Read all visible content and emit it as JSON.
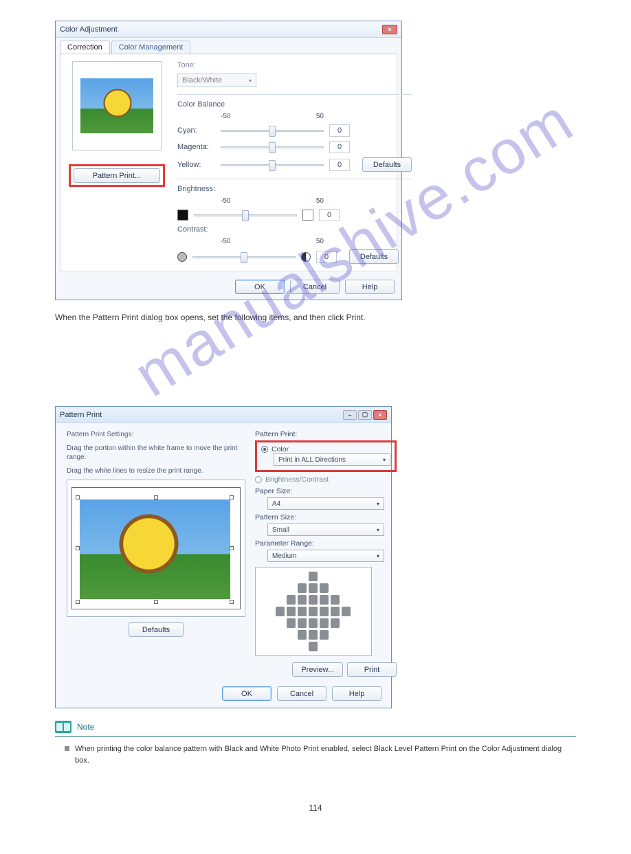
{
  "watermark": "manualshive.com",
  "intro_text": "When the Pattern Print dialog box opens, set the following items, and then click Print.",
  "dialog1": {
    "title": "Color Adjustment",
    "tabs": {
      "correction": "Correction",
      "management": "Color Management"
    },
    "tone_label": "Tone:",
    "tone_value": "Black/White",
    "color_balance_label": "Color Balance",
    "scale_min": "-50",
    "scale_max": "50",
    "cyan_label": "Cyan:",
    "magenta_label": "Magenta:",
    "yellow_label": "Yellow:",
    "zero": "0",
    "defaults_btn": "Defaults",
    "brightness_label": "Brightness:",
    "contrast_label": "Contrast:",
    "pattern_print_btn": "Pattern Print...",
    "ok": "OK",
    "cancel": "Cancel",
    "help": "Help"
  },
  "dialog2": {
    "title": "Pattern Print",
    "settings_heading": "Pattern Print Settings:",
    "hint1": "Drag the portion within the white frame to move the print range.",
    "hint2": "Drag the white lines to resize the print range.",
    "defaults_btn": "Defaults",
    "pattern_print_label": "Pattern Print:",
    "color_radio": "Color",
    "color_dd": "Print in ALL Directions",
    "bc_radio": "Brightness/Contrast",
    "paper_size_label": "Paper Size:",
    "paper_size_value": "A4",
    "pattern_size_label": "Pattern Size:",
    "pattern_size_value": "Small",
    "param_range_label": "Parameter Range:",
    "param_range_value": "Medium",
    "preview_btn": "Preview...",
    "print_btn": "Print",
    "ok": "OK",
    "cancel": "Cancel",
    "help": "Help"
  },
  "note": {
    "heading": "Note",
    "body": "When printing the color balance pattern with Black and White Photo Print enabled, select Black Level Pattern Print on the Color Adjustment dialog box."
  },
  "page_number": "114"
}
